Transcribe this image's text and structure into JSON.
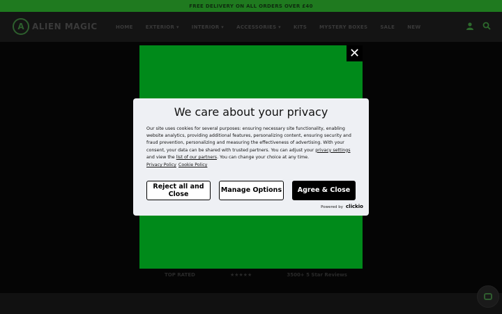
{
  "announcement": "FREE DELIVERY ON ALL ORDERS OVER £40",
  "header": {
    "logo_mark": "A",
    "logo_text": "ALIEN MAGIC",
    "nav": [
      "HOME",
      "EXTERIOR ▾",
      "INTERIOR ▾",
      "ACCESSORIES ▾",
      "KITS",
      "MYSTERY BOXES",
      "SALE",
      "NEW"
    ],
    "icons": {
      "account": "user-icon",
      "search": "search-icon"
    }
  },
  "strip": {
    "top_rated": "TOP RATED",
    "stars": "★★★★★",
    "reviews": "3500+ 5 Star Reviews"
  },
  "popup": {
    "close_glyph": "✕",
    "bg_color": "#008a1a"
  },
  "consent": {
    "title": "We care about your privacy",
    "body_1": "Our site uses cookies for several purposes: ensuring necessary site functionality, enabling website analytics, providing additional features, personalizing content, ensuring security and fraud prevention, personalizing and measuring the effectiveness of advertising. With your consent, your data can be shared with trusted partners. You can adjust your ",
    "privacy_settings": "privacy settings",
    "body_2": " and view the ",
    "partners_link": "list of our partners",
    "body_3": ". You can change your choice at any time.",
    "privacy_policy": "Privacy Policy",
    "cookie_policy": "Cookie Policy",
    "reject": "Reject all and Close",
    "manage": "Manage Options",
    "agree": "Agree & Close",
    "powered_by": "Powered by",
    "brand": "clickio"
  }
}
